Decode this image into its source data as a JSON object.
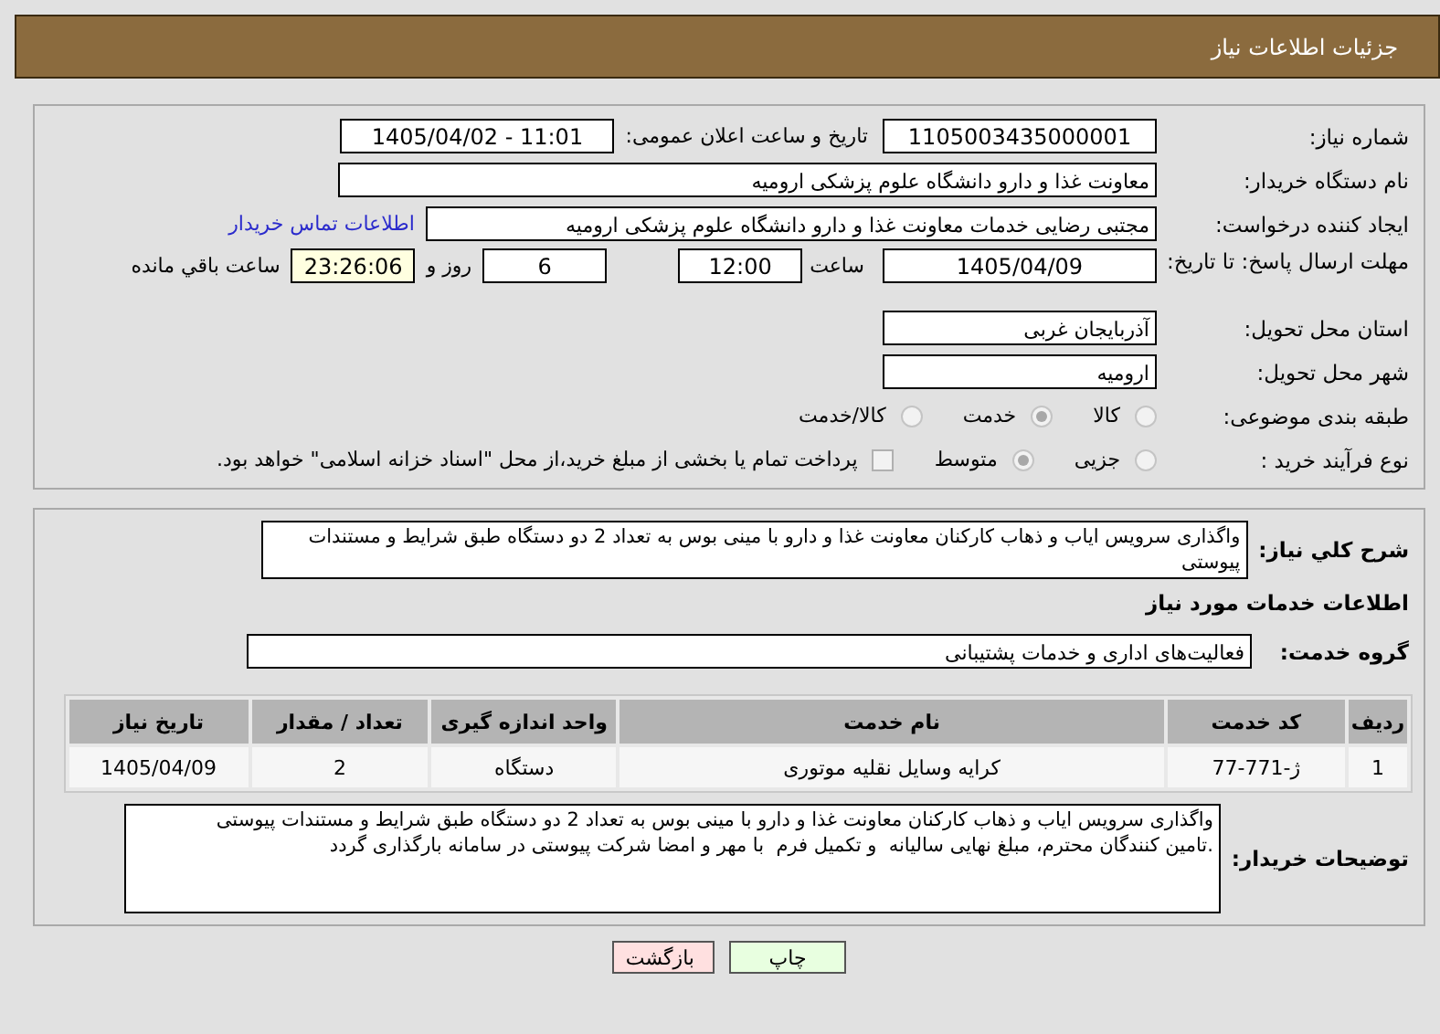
{
  "title": "جزئیات اطلاعات نیاز",
  "need_number": {
    "label": "شماره نیاز:",
    "value": "1105003435000001"
  },
  "announce": {
    "label": "تاریخ و ساعت اعلان عمومی:",
    "value": "1405/04/02 - 11:01"
  },
  "buyer_org": {
    "label": "نام دستگاه خریدار:",
    "value": "معاونت غذا و دارو دانشگاه علوم پزشکی ارومیه"
  },
  "creator": {
    "label": "ایجاد کننده درخواست:",
    "value": "مجتبی رضایی خدمات معاونت غذا و دارو دانشگاه علوم پزشکی ارومیه",
    "link": "اطلاعات تماس خریدار"
  },
  "deadline": {
    "label": "مهلت ارسال پاسخ: تا تاریخ:",
    "date": "1405/04/09",
    "time_label": "ساعت",
    "time": "12:00",
    "days": "6",
    "days_label": "روز و",
    "remaining": "23:26:06",
    "remaining_label": "ساعت باقي مانده"
  },
  "province": {
    "label": "استان محل تحویل:",
    "value": "آذربایجان غربی"
  },
  "city": {
    "label": "شهر محل تحویل:",
    "value": "ارومیه"
  },
  "category": {
    "label": "طبقه بندی موضوعی:",
    "options": [
      {
        "label": "کالا",
        "selected": false
      },
      {
        "label": "خدمت",
        "selected": true
      },
      {
        "label": "کالا/خدمت",
        "selected": false
      }
    ]
  },
  "process": {
    "label": "نوع فرآیند خرید :",
    "options": [
      {
        "label": "جزیی",
        "selected": false
      },
      {
        "label": "متوسط",
        "selected": true
      }
    ],
    "treasury": {
      "checked": false,
      "label": "پرداخت تمام یا بخشی از مبلغ خرید،از محل \"اسناد خزانه اسلامی\" خواهد بود."
    }
  },
  "description": {
    "label": "شرح کلي نياز:",
    "value": "واگذاری سرویس ایاب و ذهاب کارکنان معاونت غذا و دارو با مینی بوس به تعداد 2 دو دستگاه طبق شرایط و مستندات پیوستی"
  },
  "services_heading": "اطلاعات خدمات مورد نیاز",
  "service_group": {
    "label": "گروه خدمت:",
    "value": "فعالیت‌های اداری و خدمات پشتیبانی"
  },
  "table": {
    "columns": [
      "ردیف",
      "کد خدمت",
      "نام خدمت",
      "واحد اندازه گیری",
      "تعداد / مقدار",
      "تاریخ نیاز"
    ],
    "rows": [
      [
        "1",
        "ژ-771-77",
        "کرایه وسایل نقلیه موتوری",
        "دستگاه",
        "2",
        "1405/04/09"
      ]
    ]
  },
  "buyer_notes": {
    "label": "توضیحات خریدار:",
    "value": "واگذاری سرویس ایاب و ذهاب کارکنان معاونت غذا و دارو با مینی بوس به تعداد 2 دو دستگاه طبق شرایط و مستندات پیوستی\n.تامین کنندگان محترم، مبلغ نهایی سالیانه  و تکمیل فرم  با مهر و امضا شرکت پیوستی در سامانه بارگذاری گردد"
  },
  "buttons": [
    {
      "label": "چاپ",
      "kind": "print"
    },
    {
      "label": "بازگشت",
      "kind": "back"
    }
  ]
}
